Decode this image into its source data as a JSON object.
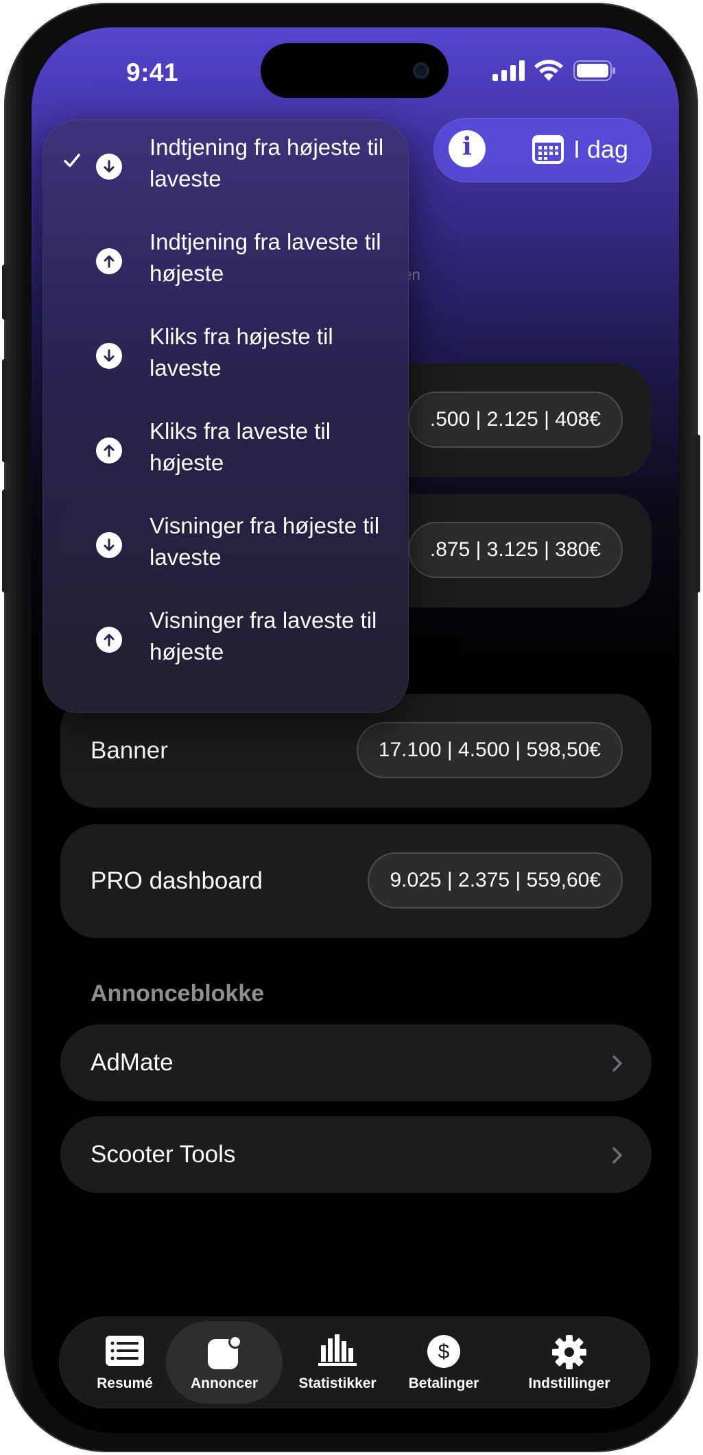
{
  "status_bar": {
    "time": "9:41"
  },
  "toolbar": {
    "date_label": "I dag"
  },
  "header": {
    "subtitle_fragment": "den"
  },
  "dropdown": {
    "items": [
      {
        "label": "Indtjening fra højeste til laveste",
        "direction": "down",
        "checked": true
      },
      {
        "label": "Indtjening fra laveste til højeste",
        "direction": "up",
        "checked": false
      },
      {
        "label": "Kliks fra højeste til laveste",
        "direction": "down",
        "checked": false
      },
      {
        "label": "Kliks fra laveste til højeste",
        "direction": "up",
        "checked": false
      },
      {
        "label": "Visninger fra højeste til laveste",
        "direction": "down",
        "checked": false
      },
      {
        "label": "Visninger fra laveste til højeste",
        "direction": "up",
        "checked": false
      }
    ]
  },
  "cards": [
    {
      "label": "",
      "stats": ".500 | 2.125 | 408€"
    },
    {
      "label": "",
      "stats": ".875 | 3.125 | 380€"
    },
    {
      "label": "Banner",
      "stats": "17.100 | 4.500 | 598,50€"
    },
    {
      "label": "PRO dashboard",
      "stats": "9.025 | 2.375 | 559,60€"
    }
  ],
  "ad_blocks": {
    "title": "Annonceblokke",
    "items": [
      {
        "label": "AdMate"
      },
      {
        "label": "Scooter Tools"
      }
    ]
  },
  "tabbar": {
    "tabs": [
      {
        "label": "Resumé",
        "icon": "list-icon"
      },
      {
        "label": "Annoncer",
        "icon": "app-badge-icon",
        "active": true
      },
      {
        "label": "Statistikker",
        "icon": "bar-chart-icon"
      },
      {
        "label": "Betalinger",
        "icon": "dollar-icon"
      },
      {
        "label": "Indstillinger",
        "icon": "gear-icon"
      }
    ]
  },
  "colors": {
    "accent": "#5546cf",
    "card": "#1c1c1e",
    "pill": "#2c2c2e"
  }
}
